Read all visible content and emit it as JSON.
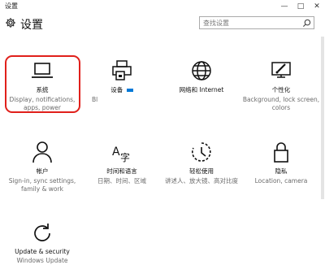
{
  "window": {
    "title": "设置",
    "min": "—",
    "max": "□",
    "close": "✕"
  },
  "header": {
    "title": "设置",
    "search_placeholder": "查找设置"
  },
  "tiles": [
    {
      "name": "系统",
      "desc": "Display, notifications, apps, power",
      "icon": "laptop-icon"
    },
    {
      "name": "设备",
      "desc": "Bl",
      "icon": "printer-icon"
    },
    {
      "name": "网络和 Internet",
      "desc": "",
      "icon": "globe-icon"
    },
    {
      "name": "个性化",
      "desc": "Background, lock screen, colors",
      "icon": "paint-icon"
    },
    {
      "name": "帐户",
      "desc": "Sign-in, sync settings, family & work",
      "icon": "person-icon"
    },
    {
      "name": "时间和语言",
      "desc": "日期、时间、区域",
      "icon": "time-language-icon"
    },
    {
      "name": "轻松使用",
      "desc": "讲述人、放大镜、高对比度",
      "icon": "ease-of-access-icon"
    },
    {
      "name": "隐私",
      "desc": "Location, camera",
      "icon": "lock-icon"
    },
    {
      "name": "Update & security",
      "desc": "Windows Update",
      "icon": "refresh-icon"
    }
  ],
  "accent": "#0078d7",
  "highlight_color": "#e0201b"
}
